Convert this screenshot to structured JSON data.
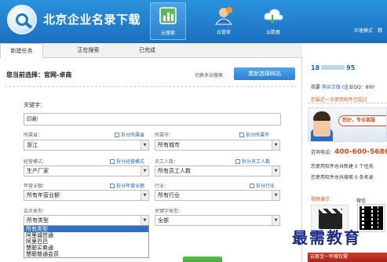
{
  "app": {
    "title": "北京企业名录下载"
  },
  "nav": {
    "items": [
      {
        "label": "云搜索",
        "icon": "cloud-search-icon",
        "active": true
      },
      {
        "label": "云管家",
        "icon": "cloud-manager-icon",
        "active": false
      },
      {
        "label": "云数据",
        "icon": "cloud-data-icon",
        "active": false
      }
    ]
  },
  "header_right": {
    "version": "中速模式",
    "extra": "精"
  },
  "tabs": [
    {
      "label": "新建任务",
      "active": true
    },
    {
      "label": "正在搜索",
      "active": false
    },
    {
      "label": "已完成",
      "active": false
    }
  ],
  "main": {
    "current_selection": "您当前选择：官网-卓商",
    "switch_link": "切换多站搜索",
    "reselect_button": "重新选择网站",
    "keyword_label": "关键字：",
    "keyword_value": "印刷",
    "fields": {
      "province": {
        "label": "所属省：",
        "value": "浙江",
        "split": "拆分所属省"
      },
      "city": {
        "label": "所属市：",
        "value": "所有城市",
        "split": "拆分所属市"
      },
      "business_mode": {
        "label": "经营模式：",
        "value": "生产厂家",
        "split": "拆分经营模式"
      },
      "employees": {
        "label": "员工人数：",
        "value": "所有员工人数",
        "split": "拆分员工人数"
      },
      "revenue": {
        "label": "年营业额：",
        "value": "所有年营业额",
        "split": "拆分年营业额"
      },
      "industry": {
        "label": "行业：",
        "value": "所有行业",
        "split": "拆分行业"
      },
      "member_type": {
        "label": "会员类型：",
        "value": "所有类型"
      },
      "keyword_type": {
        "label": "关键字类型：",
        "value": "全部"
      }
    },
    "member_type_options": [
      "所有类型",
      "阿里诚信通",
      "阿里巴巴",
      "慧聪买卖通",
      "慧聪普通会员"
    ],
    "member_type_selected_index": 0
  },
  "side": {
    "phone_prefix": "18",
    "phone_suffix": "95",
    "account_line": "我要",
    "account_link": "购买正版",
    "account_qq": "(企业QQ：800",
    "notice": "您最近一次使用软件已超过",
    "banner_text": "您好，专业客服",
    "hotline_label": "咨询电话：",
    "hotline_number": "400-600-5686",
    "stat1": "您使用软件总共新建 0 个任务",
    "stat2": "您使用软件总共搜索 0 条名录",
    "video_label": "视频演示",
    "wechat_label": "微信",
    "promo": "云客宝一年赠仅需"
  },
  "watermark": "最需教育"
}
